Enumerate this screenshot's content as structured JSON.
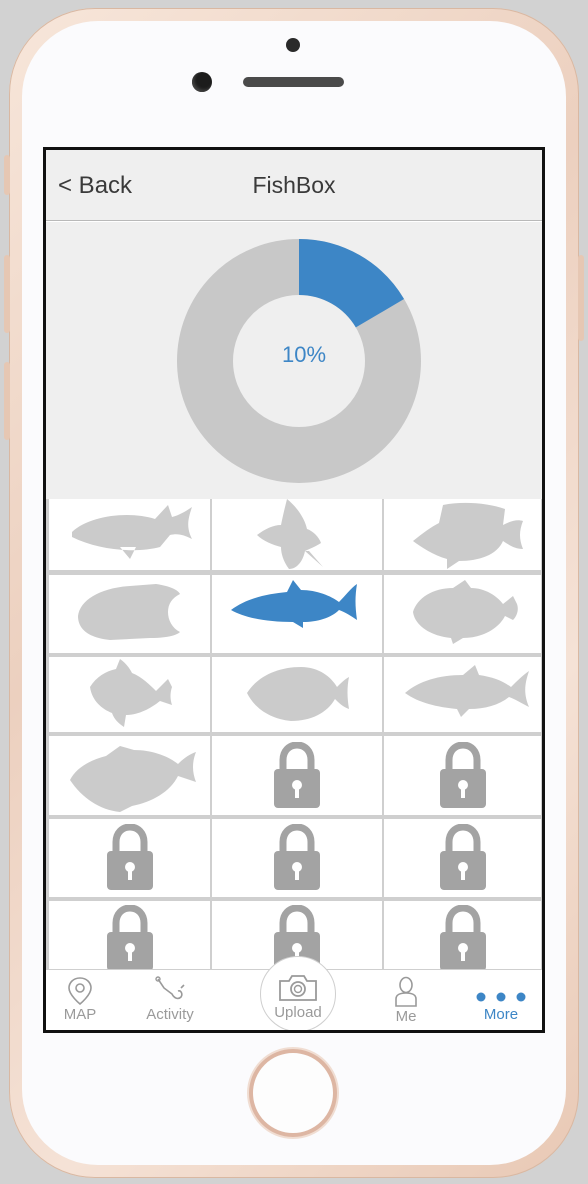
{
  "nav": {
    "back_label": "< Back",
    "title": "FishBox"
  },
  "progress": {
    "label": "10%",
    "fraction": 0.165,
    "fill_color": "#3d86c6",
    "track_color": "#c8c8c8"
  },
  "fishbox": {
    "cells": [
      {
        "type": "fish",
        "icon": "fish-icon",
        "unlocked": false
      },
      {
        "type": "fish",
        "icon": "angelfish-icon",
        "unlocked": false
      },
      {
        "type": "fish",
        "icon": "butterflyfish-icon",
        "unlocked": false
      },
      {
        "type": "fish",
        "icon": "angelfish-icon",
        "unlocked": false
      },
      {
        "type": "fish",
        "icon": "tuna-icon",
        "unlocked": true
      },
      {
        "type": "fish",
        "icon": "triggerfish-icon",
        "unlocked": false
      },
      {
        "type": "fish",
        "icon": "tetra-icon",
        "unlocked": false
      },
      {
        "type": "fish",
        "icon": "tang-icon",
        "unlocked": false
      },
      {
        "type": "fish",
        "icon": "snapper-icon",
        "unlocked": false
      },
      {
        "type": "fish",
        "icon": "grouper-icon",
        "unlocked": false
      },
      {
        "type": "lock",
        "icon": "lock-icon"
      },
      {
        "type": "lock",
        "icon": "lock-icon"
      },
      {
        "type": "lock",
        "icon": "lock-icon"
      },
      {
        "type": "lock",
        "icon": "lock-icon"
      },
      {
        "type": "lock",
        "icon": "lock-icon"
      },
      {
        "type": "lock",
        "icon": "lock-icon"
      },
      {
        "type": "lock",
        "icon": "lock-icon"
      },
      {
        "type": "lock",
        "icon": "lock-icon"
      }
    ]
  },
  "tabs": {
    "map": {
      "label": "MAP",
      "icon": "map-pin-icon"
    },
    "activity": {
      "label": "Activity",
      "icon": "fishing-hook-icon"
    },
    "upload": {
      "label": "Upload",
      "icon": "camera-icon"
    },
    "me": {
      "label": "Me",
      "icon": "person-icon"
    },
    "more": {
      "label": "More",
      "icon": "more-dots-icon"
    }
  },
  "colors": {
    "accent": "#3d86c6",
    "inactive_fish": "#cbcbcb",
    "lock": "#a3a3a3"
  }
}
